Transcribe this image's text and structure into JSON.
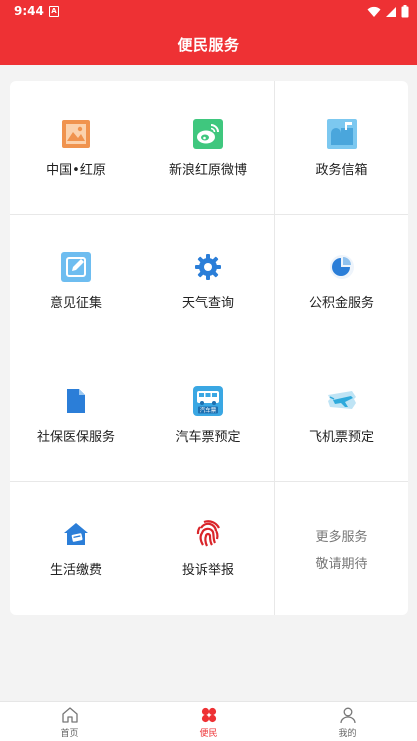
{
  "status_bar": {
    "time": "9:44",
    "notification_icon": "A"
  },
  "header": {
    "title": "便民服务"
  },
  "services": [
    {
      "label": "中国•红原",
      "icon": "picture-frame-icon"
    },
    {
      "label": "新浪红原微博",
      "icon": "weibo-icon"
    },
    {
      "label": "政务信箱",
      "icon": "mailbox-icon"
    },
    {
      "label": "意见征集",
      "icon": "edit-note-icon"
    },
    {
      "label": "天气查询",
      "icon": "gear-icon"
    },
    {
      "label": "公积金服务",
      "icon": "pie-chart-icon"
    },
    {
      "label": "社保医保服务",
      "icon": "document-icon"
    },
    {
      "label": "汽车票预定",
      "icon": "bus-ticket-icon"
    },
    {
      "label": "飞机票预定",
      "icon": "plane-ticket-icon"
    },
    {
      "label": "生活缴费",
      "icon": "house-bill-icon"
    },
    {
      "label": "投诉举报",
      "icon": "fingerprint-icon"
    }
  ],
  "more": {
    "line1": "更多服务",
    "line2": "敬请期待"
  },
  "bus_ticket_text": "汽车票",
  "tabs": [
    {
      "label": "首页",
      "icon": "home-icon",
      "active": false
    },
    {
      "label": "便民",
      "icon": "clover-icon",
      "active": true
    },
    {
      "label": "我的",
      "icon": "user-icon",
      "active": false
    }
  ],
  "colors": {
    "primary": "#ee3134",
    "background": "#f3f3f3"
  }
}
